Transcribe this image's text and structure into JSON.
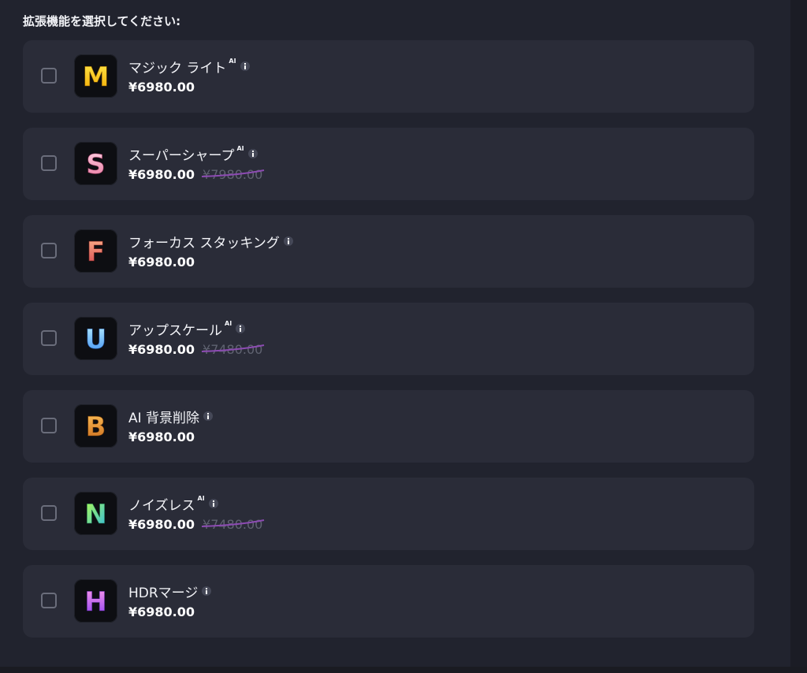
{
  "heading": "拡張機能を選択してください:",
  "extensions": [
    {
      "name": "マジック ライト",
      "ai": "AI",
      "price": "¥6980.00",
      "old_price": "",
      "letter": "M",
      "icon": "magic-light-logo-icon",
      "colors": [
        "#ffe84a",
        "#f3a900"
      ]
    },
    {
      "name": "スーパーシャープ",
      "ai": "AI",
      "price": "¥6980.00",
      "old_price": "¥7980.00",
      "letter": "S",
      "icon": "super-sharp-logo-icon",
      "colors": [
        "#ffd3e4",
        "#e8769e"
      ]
    },
    {
      "name": "フォーカス スタッキング",
      "ai": "",
      "price": "¥6980.00",
      "old_price": "",
      "letter": "F",
      "icon": "focus-stacking-logo-icon",
      "colors": [
        "#ffb48a",
        "#d2434e"
      ]
    },
    {
      "name": "アップスケール",
      "ai": "AI",
      "price": "¥6980.00",
      "old_price": "¥7480.00",
      "letter": "U",
      "icon": "upscale-logo-icon",
      "colors": [
        "#b8efff",
        "#3d8ff2"
      ]
    },
    {
      "name": "AI 背景削除",
      "ai": "",
      "price": "¥6980.00",
      "old_price": "",
      "letter": "B",
      "icon": "background-removal-logo-icon",
      "colors": [
        "#ffc25a",
        "#c8691a"
      ]
    },
    {
      "name": "ノイズレス",
      "ai": "AI",
      "price": "¥6980.00",
      "old_price": "¥7480.00",
      "letter": "N",
      "icon": "noiseless-logo-icon",
      "colors": [
        "#b6ff4a",
        "#2bb6e8"
      ]
    },
    {
      "name": "HDRマージ",
      "ai": "",
      "price": "¥6980.00",
      "old_price": "",
      "letter": "H",
      "icon": "hdr-merge-logo-icon",
      "colors": [
        "#ff9ce8",
        "#8b3ff0"
      ]
    }
  ],
  "accent": {
    "strike": "#8c4bb2",
    "card": "#2a2c38",
    "background": "#21232e"
  }
}
